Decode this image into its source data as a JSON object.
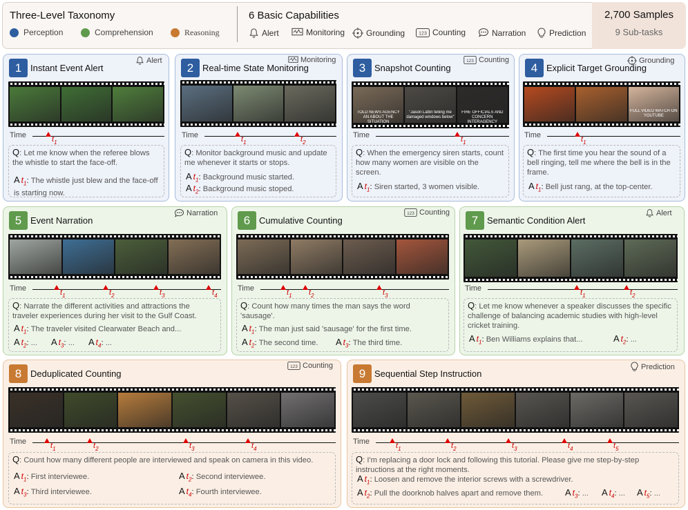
{
  "header": {
    "title": "Three-Level Taxonomy",
    "levels": [
      {
        "label": "Perception",
        "color": "#2e5da0"
      },
      {
        "label": "Comprehension",
        "color": "#5f9a4d"
      },
      {
        "label": "Reasoning",
        "color": "#c87a32"
      }
    ],
    "capabilities_title": "6 Basic Capabilities",
    "capabilities": [
      {
        "label": "Alert",
        "icon": "bell-icon"
      },
      {
        "label": "Monitoring",
        "icon": "monitor-icon"
      },
      {
        "label": "Grounding",
        "icon": "target-icon"
      },
      {
        "label": "Counting",
        "icon": "counter-icon"
      },
      {
        "label": "Narration",
        "icon": "speech-bubble-icon"
      },
      {
        "label": "Prediction",
        "icon": "bulb-icon"
      }
    ],
    "samples": "2,700 Samples",
    "subtasks": "9 Sub-tasks"
  },
  "common": {
    "time": "Time",
    "q": "Q",
    "a": "A",
    "t": "t"
  },
  "cards": [
    {
      "num": "1",
      "title": "Instant Event Alert",
      "tag": "Alert",
      "ticks": [
        "1"
      ],
      "q": "Let me know when the referee blows the whistle to start the face-off.",
      "answers": [
        {
          "sub": "1",
          "text": "The whistle just blew and the face-off is starting now."
        }
      ]
    },
    {
      "num": "2",
      "title": "Real-time State Monitoring",
      "tag": "Monitoring",
      "ticks": [
        "1",
        "2"
      ],
      "q": "Monitor background music and update me whenever it starts or stops.",
      "answers": [
        {
          "sub": "1",
          "text": "Background music started."
        },
        {
          "sub": "2",
          "text": "Background music stoped."
        }
      ]
    },
    {
      "num": "3",
      "title": "Snapshot Counting",
      "tag": "Counting",
      "ticks": [
        "1"
      ],
      "q": "When the emergency siren starts, count how many women are visible on the screen.",
      "answers": [
        {
          "sub": "1",
          "text": "Siren started, 3 women visible."
        }
      ],
      "frame_text": [
        "TOLD NEWS AGENCY AN ABOUT THE SITUATION",
        "\"Jason Lattin telling me damaged windows below\"",
        "FIRE OFFICIALS AND CONCERN INTERAGENCY OPERATION"
      ]
    },
    {
      "num": "4",
      "title": "Explicit Target Grounding",
      "tag": "Grounding",
      "ticks": [
        "1"
      ],
      "q": "The first time you hear the sound of a bell ringing, tell me where the bell is in the frame.",
      "answers": [
        {
          "sub": "1",
          "text": "Bell just rang, at the top-center."
        }
      ],
      "frame_text": [
        "FULL VIDEO WATCH ON YOUTUBE"
      ]
    },
    {
      "num": "5",
      "title": "Event Narration",
      "tag": "Narration",
      "ticks": [
        "1",
        "2",
        "3",
        "4"
      ],
      "q": "Narrate the different activities and attractions the traveler experiences during her visit to the Gulf Coast.",
      "answers": [
        {
          "sub": "1",
          "text": "The traveler visited Clearwater Beach and..."
        },
        {
          "sub": "2",
          "text": "..."
        },
        {
          "sub": "3",
          "text": "..."
        },
        {
          "sub": "4",
          "text": "..."
        }
      ]
    },
    {
      "num": "6",
      "title": "Cumulative Counting",
      "tag": "Counting",
      "ticks": [
        "1",
        "2",
        "3"
      ],
      "q": "Count how many times the man says the word 'sausage'.",
      "answers": [
        {
          "sub": "1",
          "text": "The man just said 'sausage' for the first time."
        },
        {
          "sub": "2",
          "text": "The second time."
        },
        {
          "sub": "3",
          "text": "The third time."
        }
      ]
    },
    {
      "num": "7",
      "title": "Semantic Condition Alert",
      "tag": "Alert",
      "ticks": [
        "1",
        "2"
      ],
      "q": "Let me know whenever a speaker discusses the specific challenge of balancing academic studies with high-level cricket training.",
      "answers": [
        {
          "sub": "1",
          "text": "Ben Williams explains that..."
        },
        {
          "sub": "2",
          "text": "..."
        }
      ]
    },
    {
      "num": "8",
      "title": "Deduplicated Counting",
      "tag": "Counting",
      "ticks": [
        "1",
        "2",
        "3",
        "4"
      ],
      "q": "Count how many different people are interviewed and speak on camera in this video.",
      "answers": [
        {
          "sub": "1",
          "text": "First interviewee."
        },
        {
          "sub": "2",
          "text": "Second interviewee."
        },
        {
          "sub": "3",
          "text": "Third interviewee."
        },
        {
          "sub": "4",
          "text": "Fourth interviewee."
        }
      ]
    },
    {
      "num": "9",
      "title": "Sequential Step Instruction",
      "tag": "Prediction",
      "ticks": [
        "1",
        "2",
        "3",
        "4",
        "5"
      ],
      "q": "I'm replacing a door lock and following this tutorial. Please give me step-by-step instructions at the right moments.",
      "answers": [
        {
          "sub": "1",
          "text": "Loosen and remove the interior screws with a screwdriver."
        },
        {
          "sub": "2",
          "text": "Pull the doorknob halves apart and remove them."
        },
        {
          "sub": "3",
          "text": "..."
        },
        {
          "sub": "4",
          "text": "..."
        },
        {
          "sub": "5",
          "text": "..."
        }
      ]
    }
  ]
}
